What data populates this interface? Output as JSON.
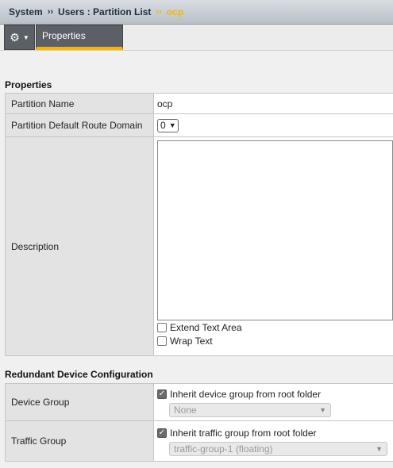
{
  "breadcrumb": {
    "items": [
      "System",
      "Users : Partition List",
      "ocp"
    ],
    "separator": "››"
  },
  "tabs": {
    "gear_icon": "gear-icon",
    "properties_label": "Properties"
  },
  "properties": {
    "title": "Properties",
    "partition_name_label": "Partition Name",
    "partition_name_value": "ocp",
    "route_domain_label": "Partition Default Route Domain",
    "route_domain_value": "0",
    "description_label": "Description",
    "description_value": "",
    "extend_text_area_label": "Extend Text Area",
    "wrap_text_label": "Wrap Text"
  },
  "redundancy": {
    "title": "Redundant Device Configuration",
    "device_group_label": "Device Group",
    "device_group_inherit_label": "Inherit device group from root folder",
    "device_group_value": "None",
    "traffic_group_label": "Traffic Group",
    "traffic_group_inherit_label": "Inherit traffic group from root folder",
    "traffic_group_value": "traffic-group-1 (floating)"
  },
  "colors": {
    "accent": "#f7b500",
    "tab_bg": "#5a6066"
  }
}
